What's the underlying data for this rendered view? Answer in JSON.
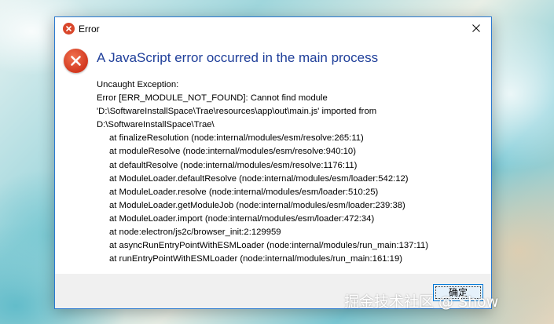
{
  "window": {
    "title": "Error",
    "border_color": "#2b79d0"
  },
  "icons": {
    "title_icon": "error-icon",
    "big_icon": "error-icon",
    "close": "close-icon",
    "error_color": "#d9472b"
  },
  "dialog": {
    "heading": "A JavaScript error occurred in the main process",
    "heading_color": "#1f3f9a",
    "message_lines": [
      "Uncaught Exception:",
      "Error [ERR_MODULE_NOT_FOUND]: Cannot find module",
      "'D:\\SoftwareInstallSpace\\Trae\\resources\\app\\out\\main.js' imported from",
      "D:\\SoftwareInstallSpace\\Trae\\"
    ],
    "stack_lines": [
      "at finalizeResolution (node:internal/modules/esm/resolve:265:11)",
      "at moduleResolve (node:internal/modules/esm/resolve:940:10)",
      "at defaultResolve (node:internal/modules/esm/resolve:1176:11)",
      "at ModuleLoader.defaultResolve (node:internal/modules/esm/loader:542:12)",
      "at ModuleLoader.resolve (node:internal/modules/esm/loader:510:25)",
      "at ModuleLoader.getModuleJob (node:internal/modules/esm/loader:239:38)",
      "at ModuleLoader.import (node:internal/modules/esm/loader:472:34)",
      "at node:electron/js2c/browser_init:2:129959",
      "at asyncRunEntryPointWithESMLoader (node:internal/modules/run_main:137:11)",
      "at runEntryPointWithESMLoader (node:internal/modules/run_main:161:19)"
    ],
    "ok_label": "确定"
  },
  "watermark": "掘金技术社区 @ Show"
}
